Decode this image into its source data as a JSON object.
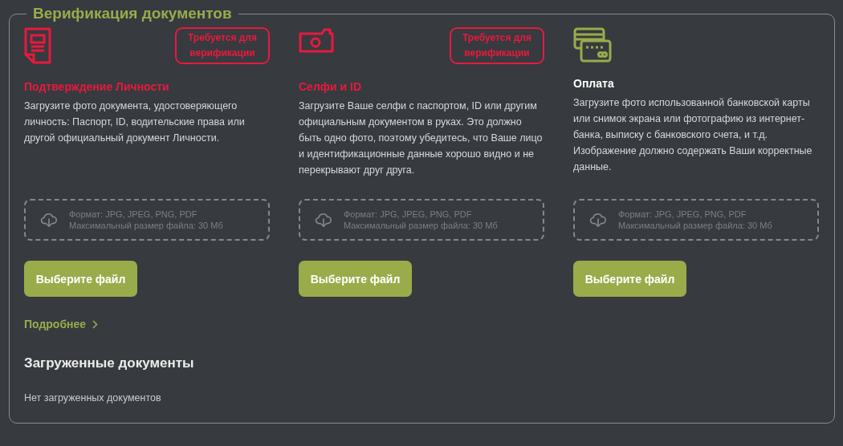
{
  "section": {
    "title": "Верификация документов"
  },
  "cards": [
    {
      "kind": "document",
      "required": true,
      "badge": "Требуется для верификации",
      "title": "Подтверждение Личности",
      "description": "Загрузите фото документа, удостоверяющего личность: Паспорт, ID, водительские права или другой официальный документ Личности.",
      "dropzone": {
        "format": "Формат: JPG, JPEG, PNG, PDF",
        "max_size": "Максимальный размер файла: 30 Мб"
      },
      "button": "Выберите файл"
    },
    {
      "kind": "camera",
      "required": true,
      "badge": "Требуется для верификации",
      "title": "Селфи и ID",
      "description": "Загрузите Ваше селфи с паспортом, ID или другим официальным документом в руках. Это должно быть одно фото, поэтому убедитесь, что Ваше лицо и идентификационные данные хорошо видно и не перекрывают друг друга.",
      "dropzone": {
        "format": "Формат: JPG, JPEG, PNG, PDF",
        "max_size": "Максимальный размер файла: 30 Мб"
      },
      "button": "Выберите файл"
    },
    {
      "kind": "card",
      "required": false,
      "title": "Оплата",
      "description": "Загрузите фото использованной банковской карты или снимок экрана или фотографию из интернет-банка, выписку с банковского счета, и т.д. Изображение должно содержать Ваши корректные данные.",
      "dropzone": {
        "format": "Формат: JPG, JPEG, PNG, PDF",
        "max_size": "Максимальный размер файла: 30 Мб"
      },
      "button": "Выберите файл"
    }
  ],
  "more_link": "Подробнее",
  "uploaded": {
    "title": "Загруженные документы",
    "empty_text": "Нет загруженных документов"
  }
}
